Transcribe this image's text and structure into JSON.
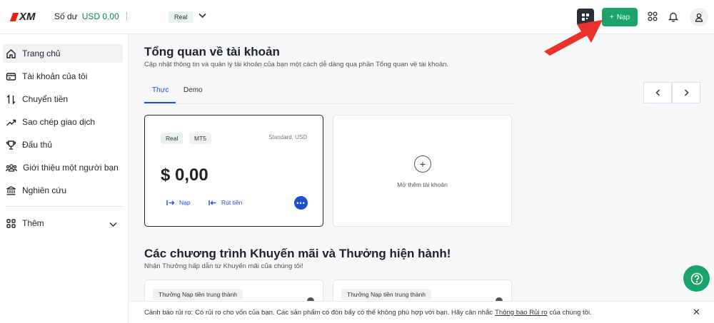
{
  "header": {
    "logo_text": "XM",
    "balance_label": "Số dư",
    "balance_value": "USD 0,00",
    "account_badge": "Real",
    "deposit_label": "Nạp",
    "icons": [
      "qr-icon",
      "apps-grid-icon",
      "bell-icon",
      "user-icon"
    ]
  },
  "sidebar": {
    "items": [
      {
        "label": "Trang chủ",
        "icon": "home-icon"
      },
      {
        "label": "Tài khoản của tôi",
        "icon": "card-icon"
      },
      {
        "label": "Chuyển tiền",
        "icon": "transfer-icon"
      },
      {
        "label": "Sao chép giao dịch",
        "icon": "trend-icon"
      },
      {
        "label": "Đấu thủ",
        "icon": "trophy-icon"
      },
      {
        "label": "Giới thiệu một người bạn",
        "icon": "people-icon"
      },
      {
        "label": "Nghiên cứu",
        "icon": "bank-icon"
      }
    ],
    "more_label": "Thêm"
  },
  "main": {
    "title": "Tổng quan về tài khoản",
    "subtitle": "Cập nhật thông tin và quản lý tài khoản của bạn một cách dễ dàng qua phần Tổng quan về tài khoản.",
    "tabs": [
      {
        "label": "Thực"
      },
      {
        "label": "Demo"
      }
    ],
    "account_card": {
      "badge_real": "Real",
      "badge_platform": "MT5",
      "account_type": "Standard, USD",
      "amount": "$ 0,00",
      "deposit_label": "Nạp",
      "withdraw_label": "Rút tiền",
      "more": "•••"
    },
    "add_card": {
      "label": "Mở thêm tài khoản",
      "plus": "+"
    },
    "promo": {
      "title": "Các chương trình Khuyến mãi và Thưởng hiện hành!",
      "subtitle": "Nhận Thưởng hấp dẫn từ Khuyến mãi của chúng tôi!",
      "cards": [
        {
          "tag": "Thưởng Nạp tiền trung thành"
        },
        {
          "tag": "Thưởng Nạp tiền trung thành"
        }
      ]
    }
  },
  "risk": {
    "prefix": "Cảnh báo rủi ro:",
    "text": "Có rủi ro cho vốn của bạn. Các sản phẩm có đòn bẩy có thể không phù hợp với bạn. Hãy cân nhắc",
    "link": "Thông báo Rủi ro",
    "suffix": "của chúng tôi.",
    "close": "✕"
  },
  "colors": {
    "brand_green": "#1aa36a",
    "accent_blue": "#1f4fd0",
    "annotation_red": "#e8322b"
  }
}
